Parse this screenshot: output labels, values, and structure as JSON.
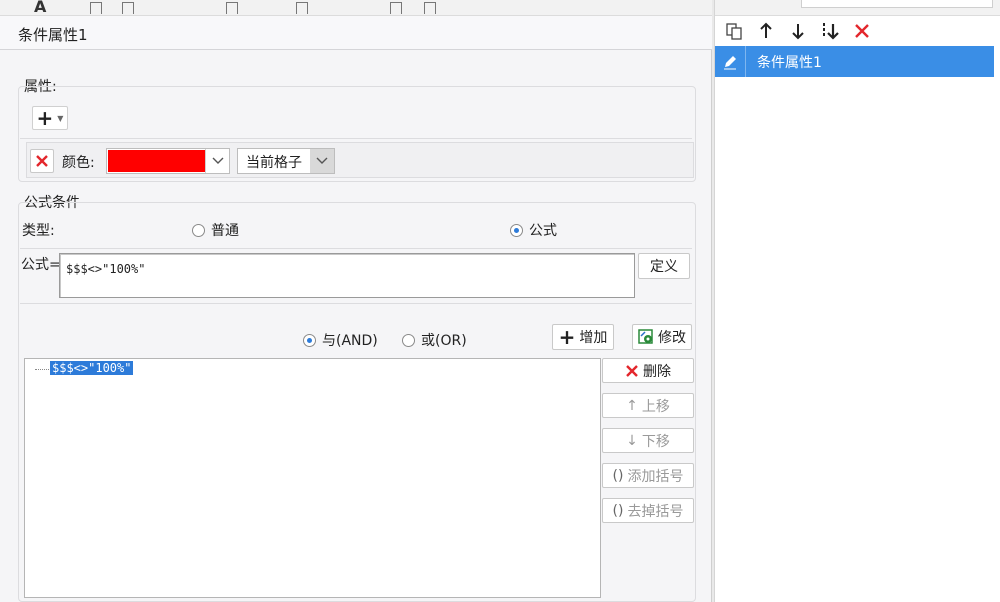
{
  "dialog": {
    "title": "条件属性1"
  },
  "attribute": {
    "group_label": "属性:",
    "add_symbol": "+",
    "color_label": "颜色:",
    "color_value": "#ff0000",
    "scope_value": "当前格子"
  },
  "formula": {
    "group_label": "公式条件",
    "type_label": "类型:",
    "type_options": [
      "普通",
      "公式"
    ],
    "type_selected": "公式",
    "formula_label": "公式=",
    "formula_value": "$$$<>\"100%\"",
    "define_label": "定义",
    "logic_options": [
      "与(AND)",
      "或(OR)"
    ],
    "logic_selected": "与(AND)",
    "add_label": "增加",
    "modify_label": "修改",
    "tree_item": "$$$<>\"100%\"",
    "delete_label": "删除",
    "move_up_label": "上移",
    "move_down_label": "下移",
    "add_paren_label": "添加括号",
    "remove_paren_label": "去掉括号"
  },
  "right_panel": {
    "items": [
      "条件属性1"
    ],
    "tool_icons": [
      "copy-icon",
      "arrow-up-icon",
      "arrow-down-icon",
      "move-bottom-icon",
      "delete-icon"
    ]
  }
}
